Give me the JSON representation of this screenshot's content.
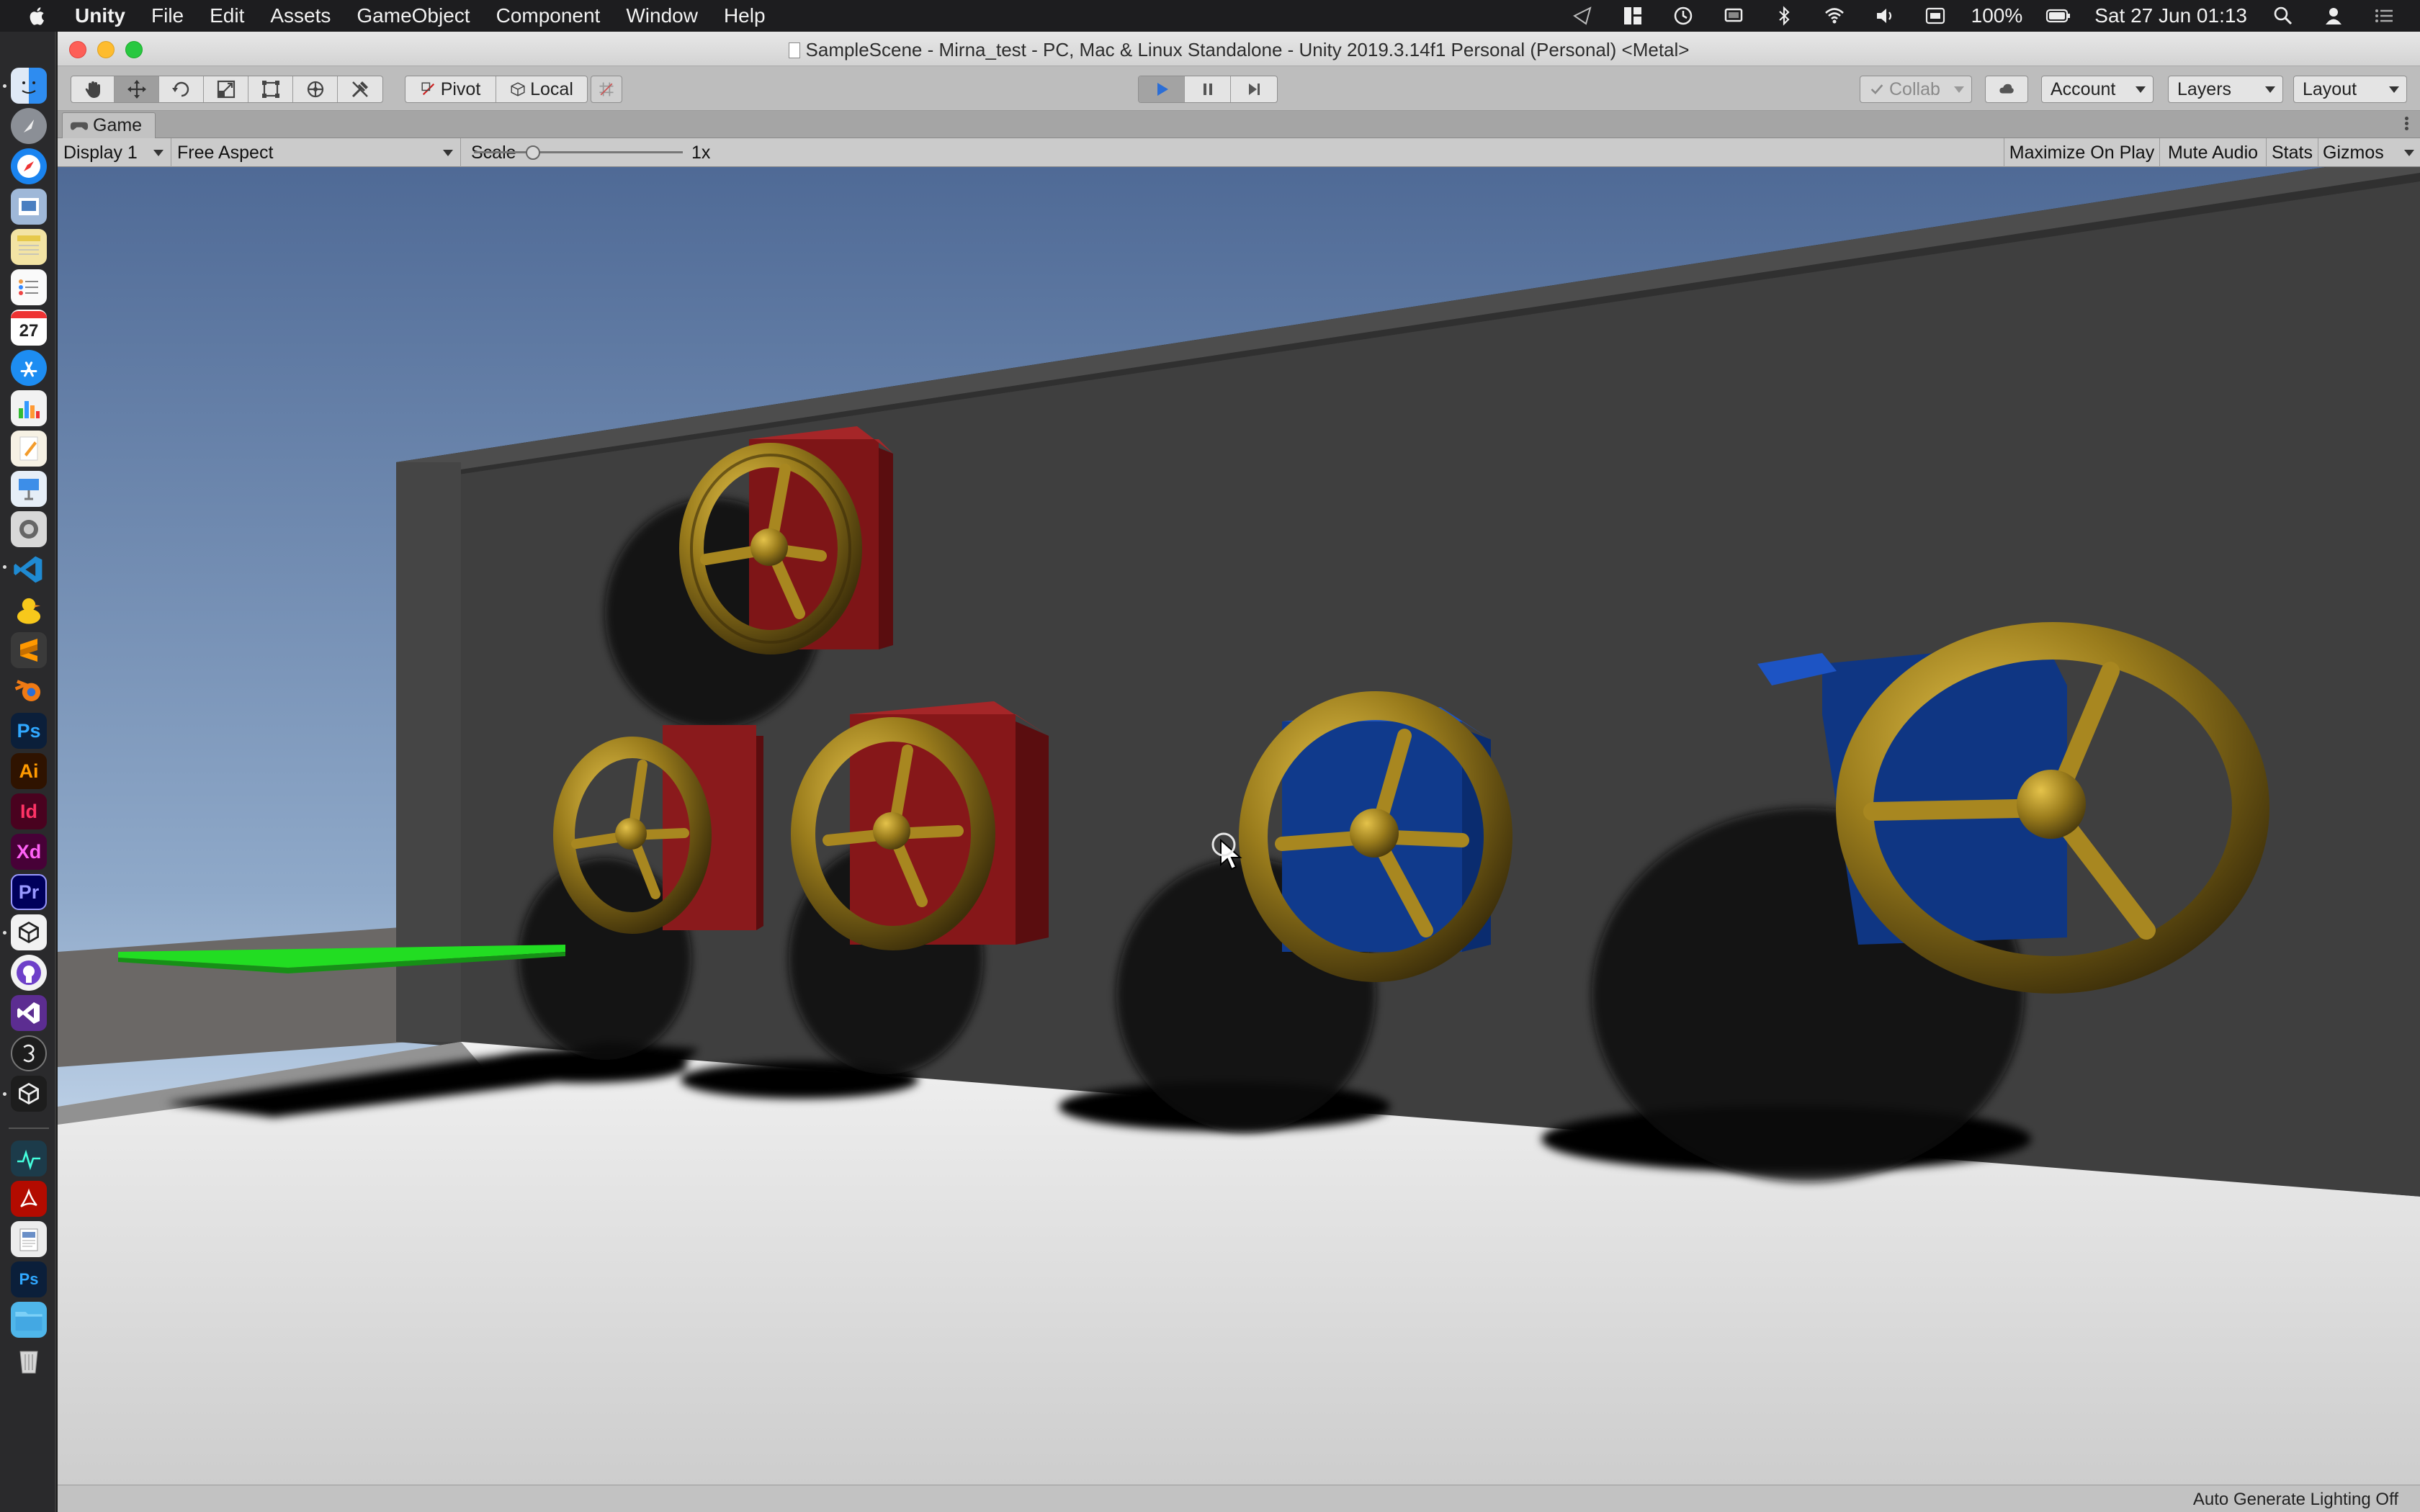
{
  "menubar": {
    "app_name": "Unity",
    "items": [
      "File",
      "Edit",
      "Assets",
      "GameObject",
      "Component",
      "Window",
      "Help"
    ],
    "battery": "100%",
    "clock": "Sat 27 Jun  01:13"
  },
  "dock": {
    "calendar_day": "27",
    "app_labels": {
      "photoshop": "Ps",
      "illustrator": "Ai",
      "indesign": "Id",
      "xd": "Xd",
      "premiere": "Pr",
      "psd_file": "Ps"
    }
  },
  "window": {
    "title": "SampleScene - Mirna_test - PC, Mac & Linux Standalone - Unity 2019.3.14f1 Personal (Personal) <Metal>"
  },
  "toolbar": {
    "pivot_label": "Pivot",
    "local_label": "Local",
    "collab_label": "Collab",
    "account_label": "Account",
    "layers_label": "Layers",
    "layout_label": "Layout",
    "play_color": "#2b6ed6"
  },
  "game_tab": {
    "label": "Game",
    "display": "Display 1",
    "aspect": "Free Aspect",
    "scale_label": "Scale",
    "scale_value": "1x",
    "maximize_on_play": "Maximize On Play",
    "mute_audio": "Mute Audio",
    "stats": "Stats",
    "gizmos": "Gizmos"
  },
  "scene": {
    "sky_top": "#4f6a96",
    "sky_horizon": "#cfe0f2",
    "wall_color": "#3c3c3c",
    "floor_color": "#e2e2e2",
    "wheel_color": "#8a6f16",
    "red_block": "#8e1a1c",
    "blue_block": "#103a8c",
    "platform_color": "#22dd22"
  },
  "status": {
    "text": "Auto Generate Lighting Off"
  }
}
